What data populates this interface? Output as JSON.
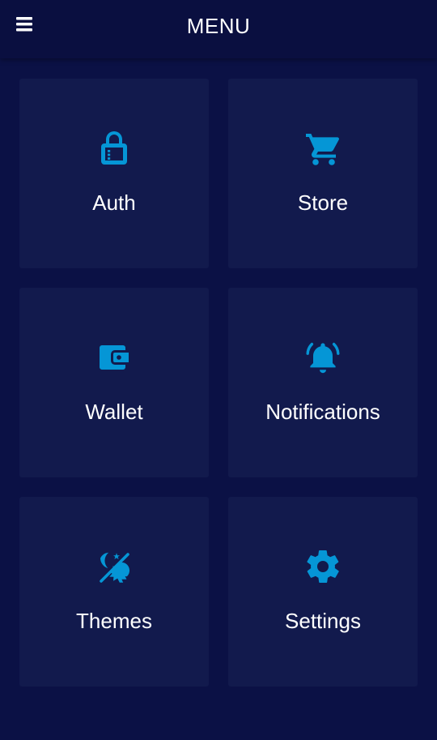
{
  "app_bar": {
    "title": "MENU",
    "menu_icon": "hamburger-menu-icon"
  },
  "accent_color": "#0596d6",
  "tiles": [
    {
      "label": "Auth",
      "icon": "lock-icon"
    },
    {
      "label": "Store",
      "icon": "cart-icon"
    },
    {
      "label": "Wallet",
      "icon": "wallet-icon"
    },
    {
      "label": "Notifications",
      "icon": "bell-ringing-icon"
    },
    {
      "label": "Themes",
      "icon": "theme-icon"
    },
    {
      "label": "Settings",
      "icon": "gear-icon"
    }
  ]
}
